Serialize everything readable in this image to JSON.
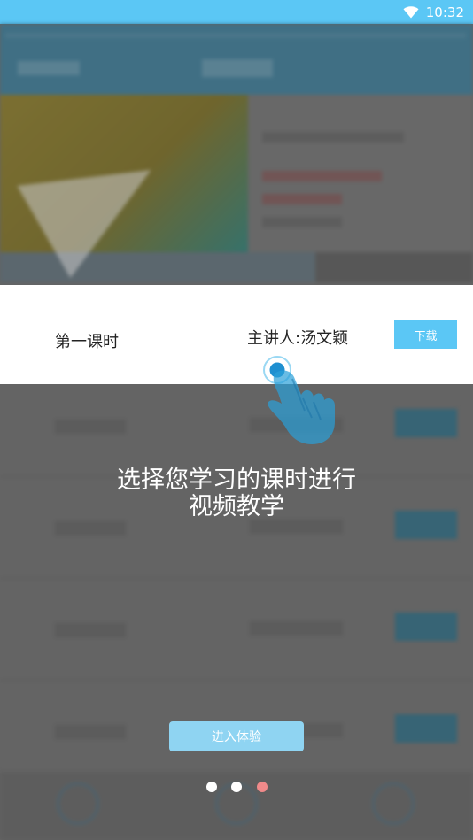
{
  "status_bar": {
    "time": "10:32",
    "wifi_icon": "wifi-icon"
  },
  "highlight_row": {
    "title": "第一课时",
    "speaker": "主讲人:汤文颖",
    "download_label": "下载"
  },
  "guide": {
    "line1": "选择您学习的课时进行",
    "line2": "视频教学"
  },
  "enter_button": {
    "label": "进入体验"
  },
  "pager": {
    "total": 3,
    "active_index": 2
  },
  "colors": {
    "status_bar": "#5bc7f5",
    "accent": "#5bc7f5",
    "active_dot": "#f08a8a",
    "enter_button": "#8fd4f2"
  },
  "icons": {
    "pointer": "hand-pointer-icon",
    "tap": "tap-ripple-icon"
  }
}
